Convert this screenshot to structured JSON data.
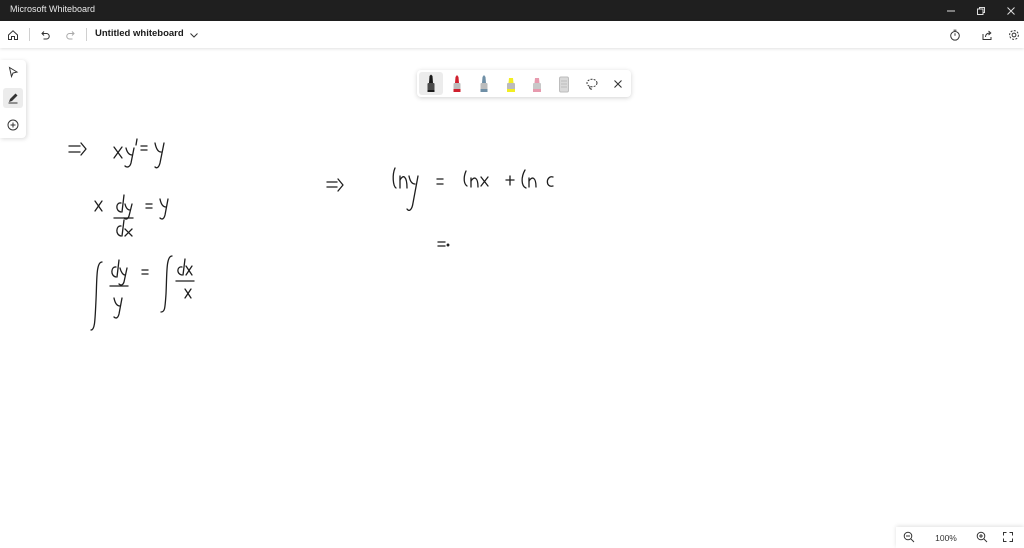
{
  "window": {
    "title": "Microsoft Whiteboard"
  },
  "appbar": {
    "document_title": "Untitled whiteboard"
  },
  "pen_tray": {
    "tools": [
      {
        "name": "black-pen",
        "color": "#1a1a1a"
      },
      {
        "name": "red-pen",
        "color": "#d0202e"
      },
      {
        "name": "blue-pen",
        "color": "#6f8fa6"
      },
      {
        "name": "yellow-highlighter",
        "color": "#f2ee22"
      },
      {
        "name": "pink-highlighter",
        "color": "#e79aae"
      },
      {
        "name": "eraser",
        "color": "#bdbdbd"
      }
    ]
  },
  "zoom": {
    "level": "100%"
  },
  "colors": {
    "titlebar": "#1f1f1f",
    "ink": "#1e1e1e"
  }
}
